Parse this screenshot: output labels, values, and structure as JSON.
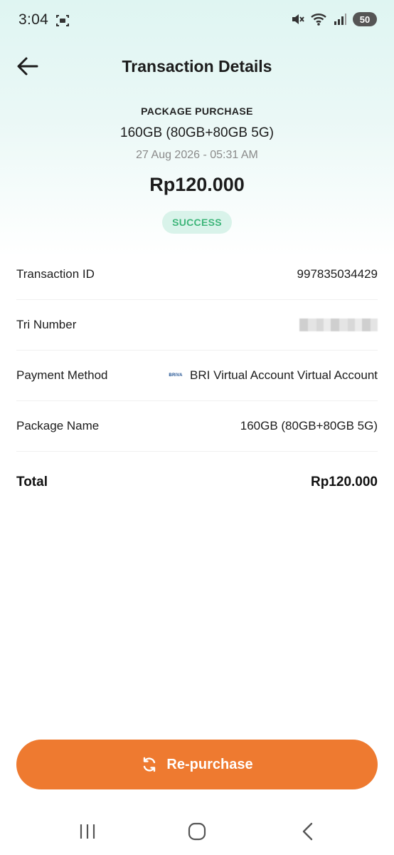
{
  "status_bar": {
    "time": "3:04",
    "battery": "50"
  },
  "header": {
    "title": "Transaction Details"
  },
  "summary": {
    "type": "PACKAGE PURCHASE",
    "package": "160GB (80GB+80GB 5G)",
    "date": "27 Aug 2026 - 05:31 AM",
    "amount": "Rp120.000",
    "status": "SUCCESS"
  },
  "details": {
    "transaction_id": {
      "label": "Transaction ID",
      "value": "997835034429"
    },
    "tri_number": {
      "label": "Tri Number"
    },
    "payment_method": {
      "label": "Payment Method",
      "logo_text": "BRIVA",
      "value": "BRI Virtual Account Virtual Account"
    },
    "package_name": {
      "label": "Package Name",
      "value": "160GB (80GB+80GB 5G)"
    },
    "total": {
      "label": "Total",
      "value": "Rp120.000"
    }
  },
  "actions": {
    "repurchase_label": "Re-purchase"
  },
  "colors": {
    "accent": "#ee7a30",
    "success_text": "#3fb67b",
    "success_bg": "#d9f3ea"
  }
}
